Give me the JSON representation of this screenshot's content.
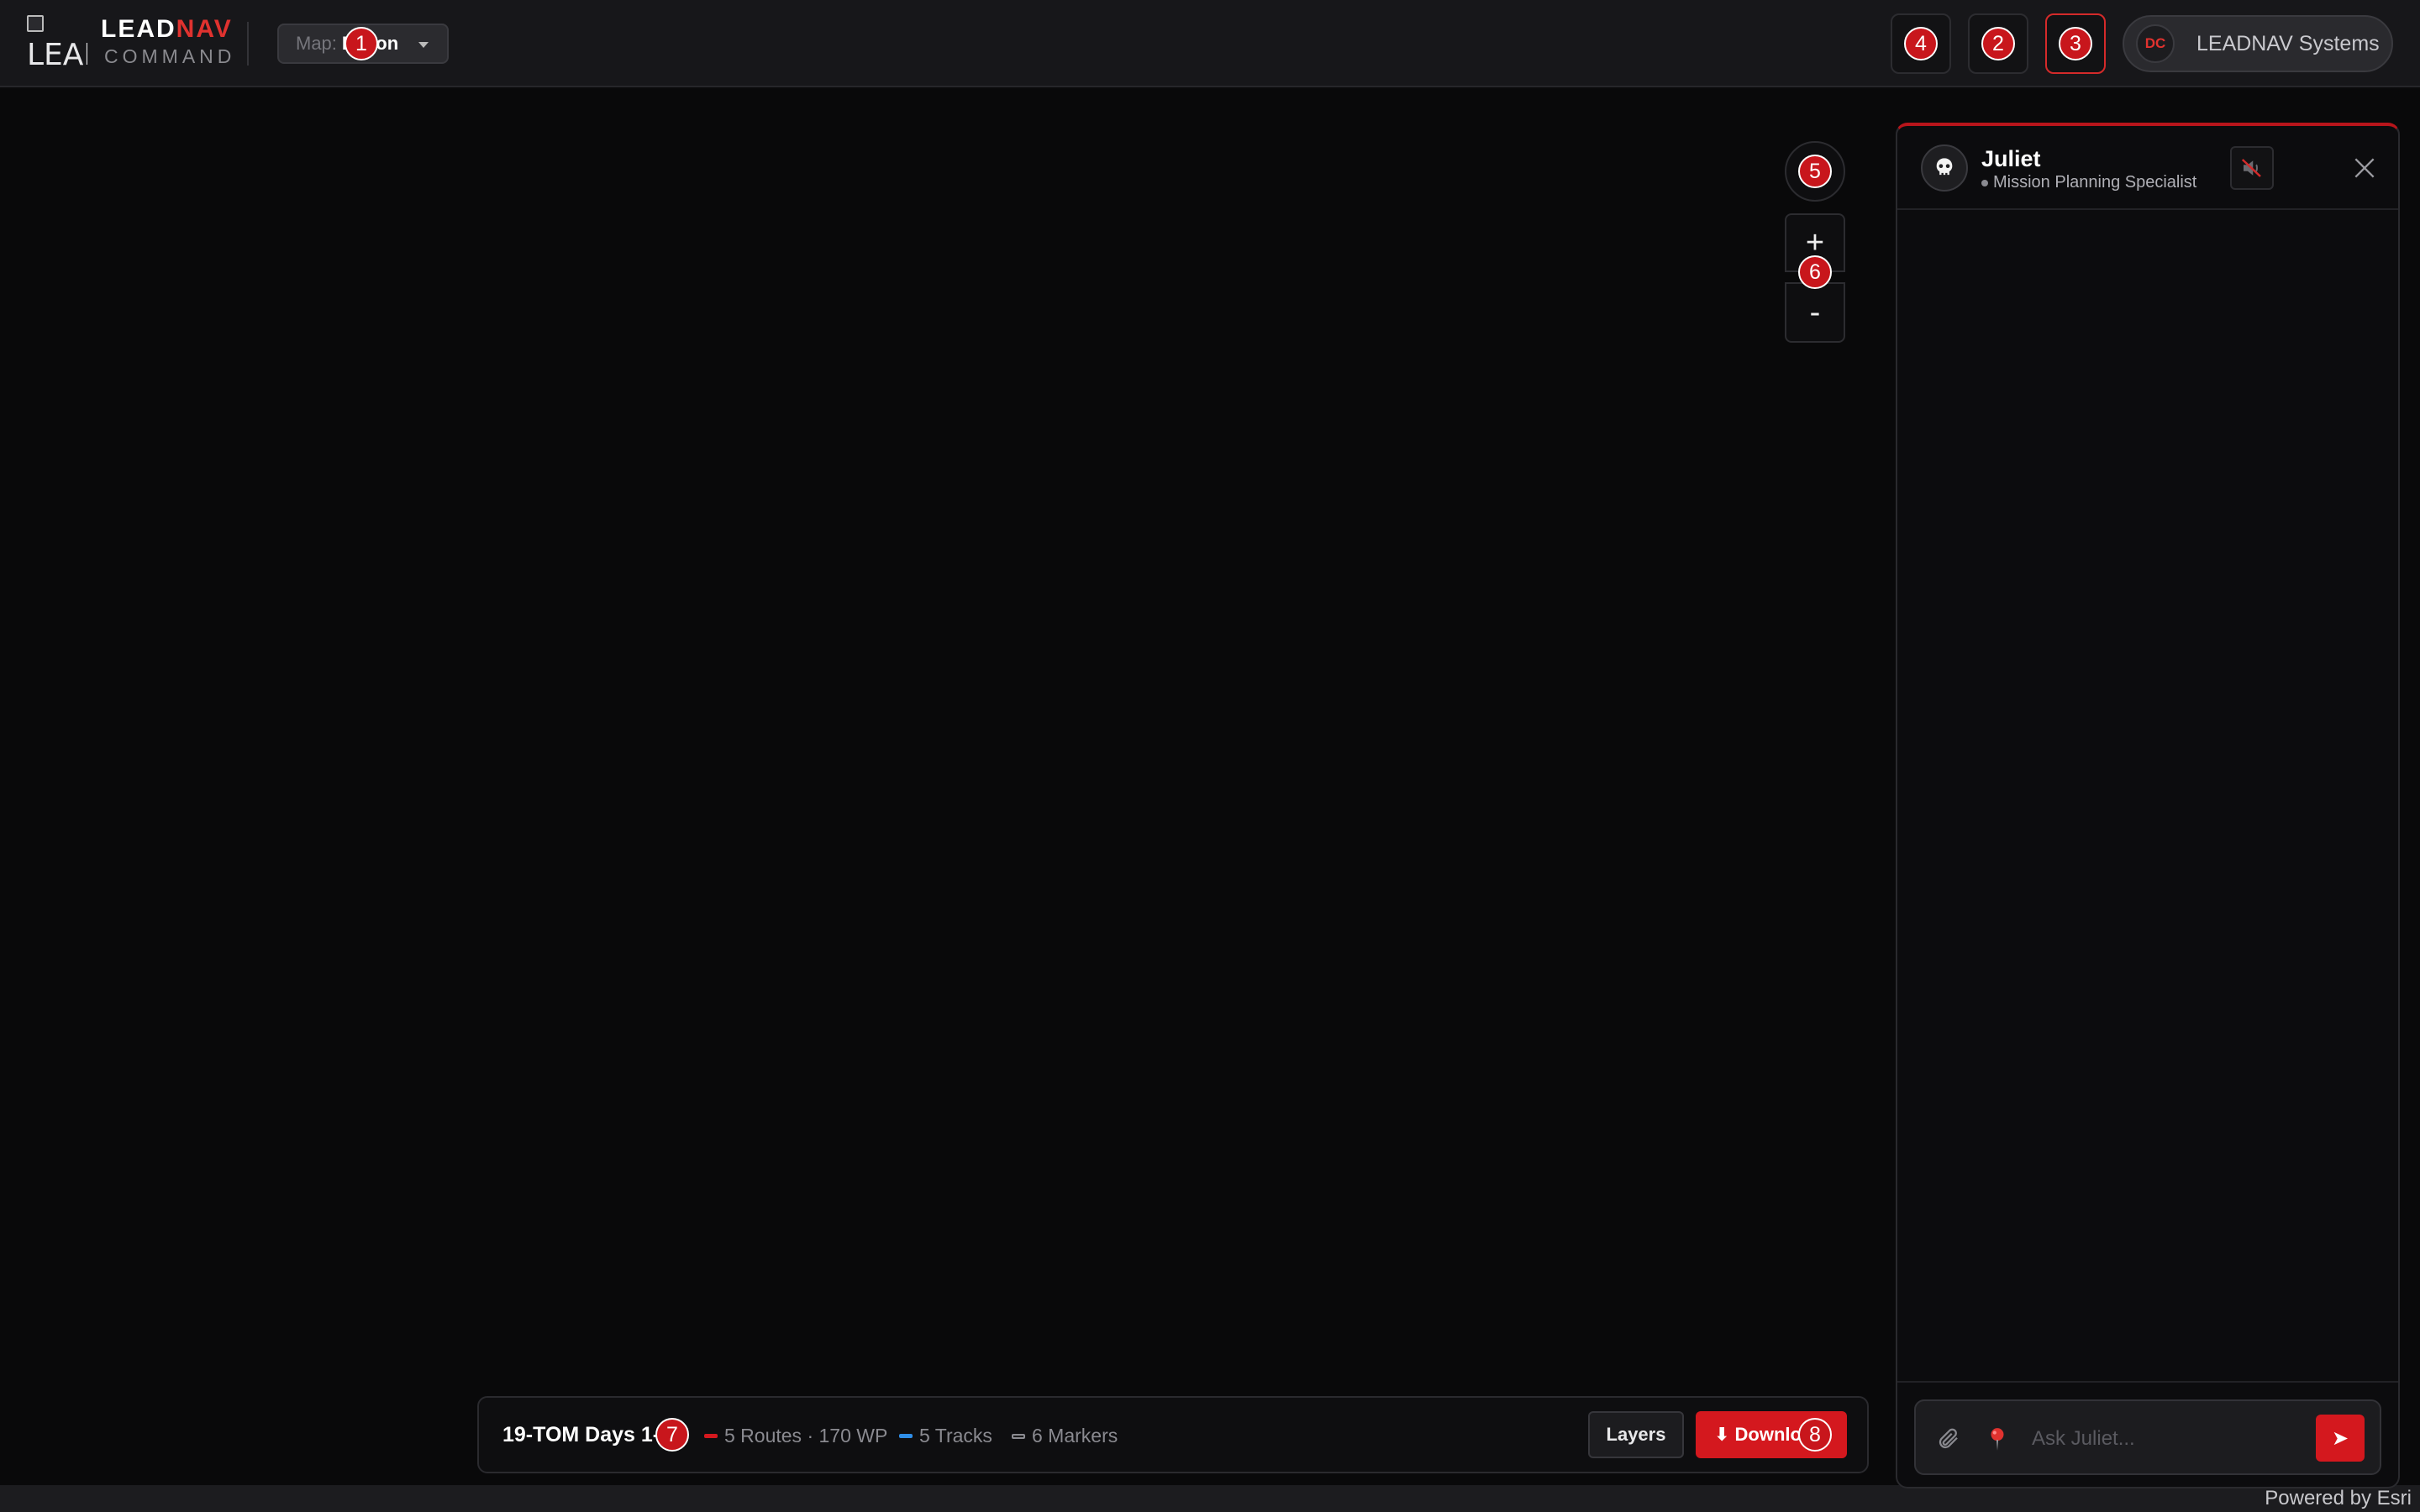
{
  "header": {
    "logo_alt": "LEAD",
    "brand_lead": "LEAD",
    "brand_nav": "NAV",
    "brand_sub": "COMMAND",
    "map_select": {
      "label": "Map:",
      "value": "Recon"
    },
    "user": {
      "initials": "DC",
      "name": "LEADNAV Systems"
    }
  },
  "badges": [
    "1",
    "2",
    "3",
    "4",
    "5",
    "6",
    "7",
    "8"
  ],
  "map": {
    "zoom_in_label": "+",
    "zoom_out_label": "-",
    "attribution": "Powered by Esri"
  },
  "mission_bar": {
    "title": "19-TOM Days 1-3",
    "routes": "5 Routes · 170 WP",
    "tracks": "5 Tracks",
    "markers": "6 Markers",
    "layers_label": "Layers",
    "download_label": "⬇ Download"
  },
  "chat": {
    "agent_name": "Juliet",
    "agent_role": "Mission Planning Specialist",
    "input_placeholder": "Ask Juliet...",
    "send_label": "➤"
  },
  "colors": {
    "accent": "#d4181e",
    "routes": "#d4181e",
    "tracks": "#2f8ee8",
    "markers": "#8a8a90"
  }
}
